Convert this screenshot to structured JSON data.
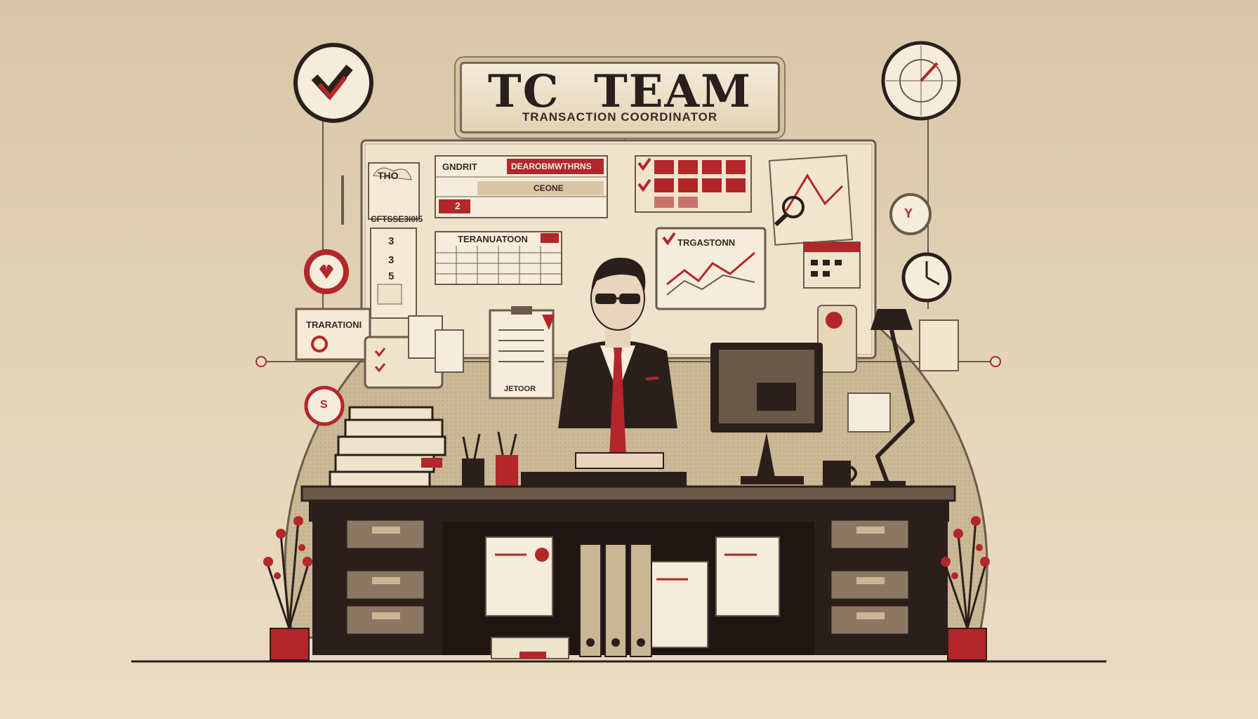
{
  "title": {
    "main": "TC  TEAM",
    "sub": "TRANSACTION COORDINATOR"
  },
  "board_labels": {
    "tag_cloud": "THO",
    "gndrit": "GNDRIT",
    "red_header": "DEAROBMWTHRNS",
    "row_marker": "2",
    "row_text": "CEONE",
    "number_code": "CFTSSE3I0I5",
    "num_1": "3",
    "num_2": "3",
    "num_3": "5",
    "planner": "TERANUATOON",
    "trend_chart": "TRGASTONN",
    "transaction_sign": "TRARATIONI",
    "clipboard_footer": "JETOOR",
    "clock_letter": "Y",
    "coin_letter": "S"
  },
  "colors": {
    "accent_red": "#b3262a",
    "dark": "#2b1f1c",
    "paper": "#f2e8d4",
    "sepia": "#c9b694",
    "line": "#6b5a4a"
  },
  "icons": [
    "checkmark-icon",
    "clock-icon",
    "target-clock-icon",
    "heart-icon",
    "coin-icon",
    "magnifier-icon",
    "calendar-icon",
    "lamp-icon",
    "computer-monitor-icon",
    "coffee-mug-icon",
    "pencil-cup-icon",
    "plant-icon"
  ]
}
